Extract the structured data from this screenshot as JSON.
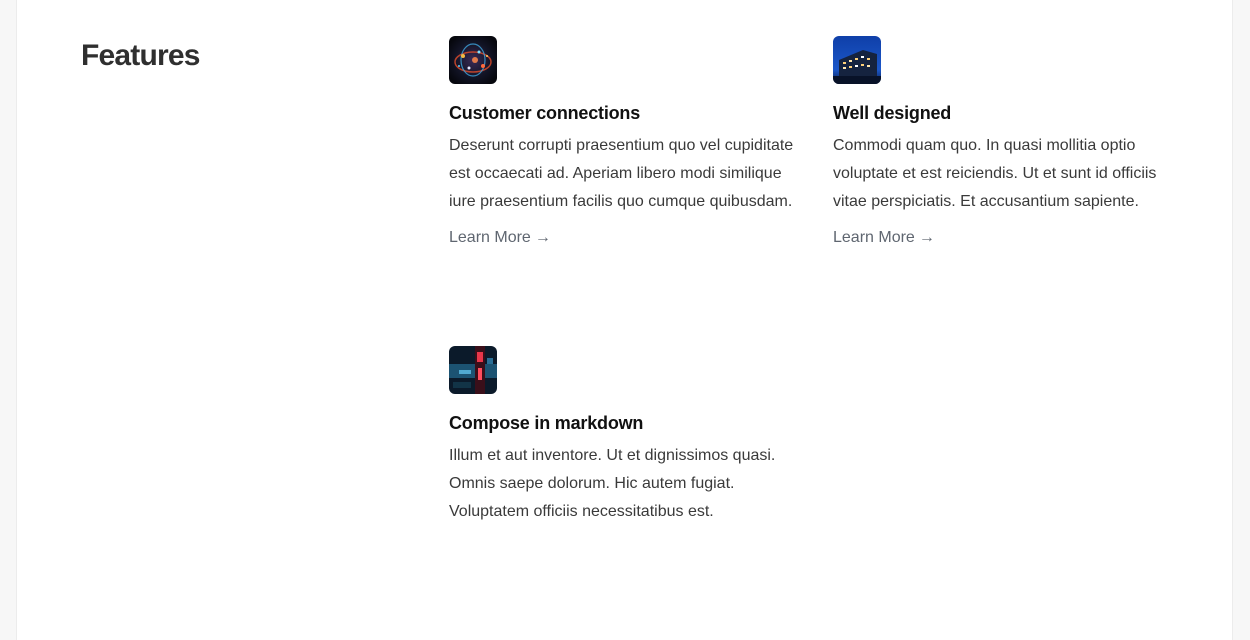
{
  "section": {
    "title": "Features"
  },
  "features": [
    {
      "title": "Customer connections",
      "description": "Deserunt corrupti praesentium quo vel cupiditate est occaecati ad. Aperiam libero modi similique iure praesentium facilis quo cumque quibusdam.",
      "link_label": "Learn More",
      "arrow": "→",
      "icon": "network-globe-image"
    },
    {
      "title": "Well designed",
      "description": "Commodi quam quo. In quasi mollitia optio voluptate et est reiciendis. Ut et sunt id officiis vitae perspiciatis. Et accusantium sapiente.",
      "link_label": "Learn More",
      "arrow": "→",
      "icon": "building-night-image"
    },
    {
      "title": "Compose in markdown",
      "description": "Illum et aut inventore. Ut et dignissimos quasi. Omnis saepe dolorum. Hic autem fugiat. Voluptatem officiis necessitatibus est.",
      "icon": "neon-abstract-image"
    }
  ]
}
